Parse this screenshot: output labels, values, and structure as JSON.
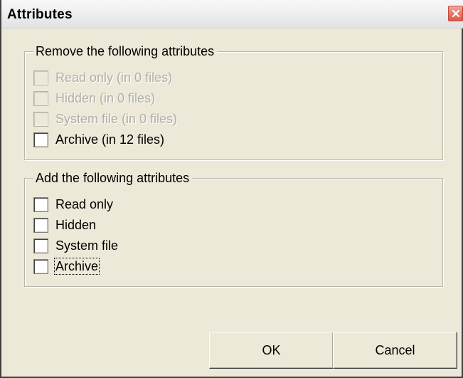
{
  "window": {
    "title": "Attributes",
    "close_icon": "close-icon"
  },
  "remove_group": {
    "legend": "Remove the following attributes",
    "items": [
      {
        "label": "Read only (in 0 files)",
        "checked": false,
        "enabled": false
      },
      {
        "label": "Hidden (in 0 files)",
        "checked": false,
        "enabled": false
      },
      {
        "label": "System file (in 0 files)",
        "checked": false,
        "enabled": false
      },
      {
        "label": "Archive (in 12 files)",
        "checked": false,
        "enabled": true
      }
    ]
  },
  "add_group": {
    "legend": "Add the following attributes",
    "items": [
      {
        "label": "Read only",
        "checked": false,
        "enabled": true
      },
      {
        "label": "Hidden",
        "checked": false,
        "enabled": true
      },
      {
        "label": "System file",
        "checked": false,
        "enabled": true
      },
      {
        "label": "Archive",
        "checked": false,
        "enabled": true,
        "focused": true
      }
    ]
  },
  "buttons": {
    "ok_label": "OK",
    "cancel_label": "Cancel"
  },
  "colors": {
    "dialog_background": "#ece9d8",
    "close_button": "#e9796b",
    "disabled_text": "#b0afa8"
  }
}
